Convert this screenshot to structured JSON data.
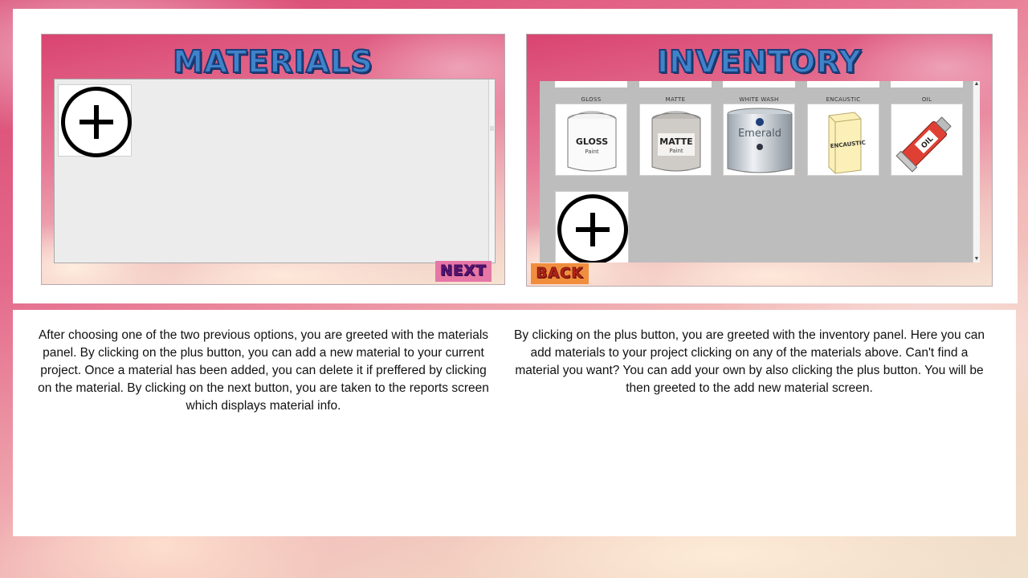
{
  "materials_screen": {
    "title": "MATERIALS",
    "next_label": "NEXT"
  },
  "inventory_screen": {
    "title": "INVENTORY",
    "back_label": "BACK",
    "items": [
      {
        "caption": "GLOSS",
        "label": "GLOSS",
        "sublabel": "Paint",
        "icon": "gloss-paint-can-icon"
      },
      {
        "caption": "MATTE",
        "label": "MATTE",
        "sublabel": "Paint",
        "icon": "matte-paint-can-icon"
      },
      {
        "caption": "WHITE WASH",
        "label": "Emerald",
        "icon": "emerald-paint-can-icon"
      },
      {
        "caption": "ENCAUSTIC",
        "label": "ENCAUSTIC",
        "icon": "encaustic-wax-block-icon"
      },
      {
        "caption": "OIL",
        "label": "OIL",
        "icon": "oil-paint-tube-icon"
      }
    ]
  },
  "descriptions": {
    "left": "After choosing one of the two previous options, you are greeted with the materials panel. By clicking on the plus button, you can add a new material to your current project. Once a material has been added, you can delete it if preffered by clicking on the material. By clicking on the next button, you are taken to the reports screen which displays material info.",
    "right": "By clicking on the plus button, you are greeted with the inventory panel. Here you can add materials to your project clicking on any of the materials above. Can't find a material you want? You can add your own by also clicking the plus button. You will be then greeted to the add new material screen."
  },
  "colors": {
    "title_blue": "#3f83c9",
    "next_bg": "#e676a6",
    "back_bg": "#f08e3e"
  }
}
